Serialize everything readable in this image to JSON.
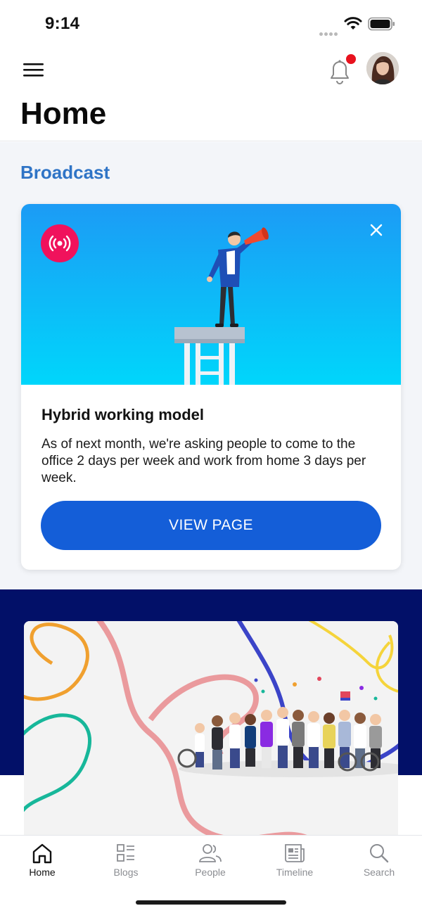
{
  "status_bar": {
    "time": "9:14"
  },
  "header": {
    "title": "Home"
  },
  "section": {
    "title": "Broadcast"
  },
  "broadcast": {
    "title": "Hybrid working model",
    "body": "As of next month, we're asking people to come to the office 2 days per week and work from home 3 days per week.",
    "button_label": "VIEW PAGE"
  },
  "tabs": [
    {
      "label": "Home",
      "icon": "home-icon",
      "active": true
    },
    {
      "label": "Blogs",
      "icon": "blogs-icon",
      "active": false
    },
    {
      "label": "People",
      "icon": "people-icon",
      "active": false
    },
    {
      "label": "Timeline",
      "icon": "timeline-icon",
      "active": false
    },
    {
      "label": "Search",
      "icon": "search-icon",
      "active": false
    }
  ],
  "colors": {
    "accent": "#145ed8",
    "section_title": "#2f74c6",
    "badge": "#f0125c",
    "notification_dot": "#e8121e",
    "navy": "#021068"
  }
}
